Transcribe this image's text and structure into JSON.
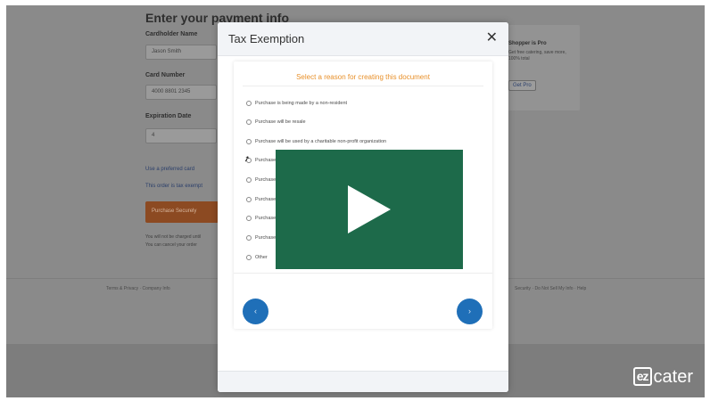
{
  "background_page": {
    "heading": "Enter your payment info",
    "cardholder_label": "Cardholder Name",
    "cardholder_value": "Jason Smith",
    "card_number_label": "Card Number",
    "card_number_value": "4000 8801 2345",
    "expiration_label": "Expiration Date",
    "expiration_month": "4",
    "link_1": "Use a preferred card",
    "link_2": "This order is tax exempt",
    "submit_label": "Purchase Securely",
    "note_1": "You will not be charged until",
    "note_2": "You can cancel your order",
    "side_card_title": "Shopper is Pro",
    "side_card_text": "Get free catering, save more, 100% total",
    "side_card_button": "Get Pro",
    "footer_left": "Terms & Privacy · Company Info",
    "footer_right": "Security · Do Not Sell My Info · Help"
  },
  "modal": {
    "title": "Tax Exemption",
    "close_icon": "close-icon",
    "prompt": "Select a reason for creating this document",
    "options": [
      "Purchase is being made by a non-resident",
      "Purchase will be resale",
      "Purchase will be used by a charitable non-profit organization",
      "Purchase",
      "Purchase",
      "Purchase",
      "Purchase",
      "Purchase",
      "Other"
    ],
    "prev_icon": "chevron-left-icon",
    "next_icon": "chevron-right-icon",
    "prev_label": "‹",
    "next_label": "›"
  },
  "video_overlay": {
    "icon": "play-icon",
    "color": "#1d6a4a"
  },
  "brand": {
    "logo_ez": "ez",
    "logo_cater": "cater"
  }
}
